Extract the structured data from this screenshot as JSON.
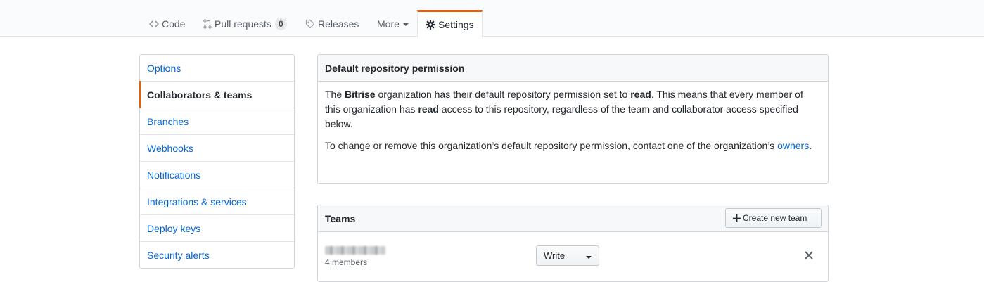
{
  "tabs": [
    {
      "icon": "code-icon",
      "label": "Code"
    },
    {
      "icon": "pull-request-icon",
      "label": "Pull requests",
      "count": "0"
    },
    {
      "icon": "tag-icon",
      "label": "Releases"
    },
    {
      "label": "More"
    },
    {
      "icon": "gear-icon",
      "label": "Settings",
      "selected": true
    }
  ],
  "sidebar": {
    "items": [
      {
        "label": "Options"
      },
      {
        "label": "Collaborators & teams",
        "selected": true
      },
      {
        "label": "Branches"
      },
      {
        "label": "Webhooks"
      },
      {
        "label": "Notifications"
      },
      {
        "label": "Integrations & services"
      },
      {
        "label": "Deploy keys"
      },
      {
        "label": "Security alerts"
      }
    ]
  },
  "permission": {
    "title": "Default repository permission",
    "p1": {
      "t1": "The ",
      "org": "Bitrise",
      "t2": " organization has their default repository permission set to ",
      "level": "read",
      "t3": ". This means that every member of this organization has ",
      "level2": "read",
      "t4": " access to this repository, regardless of the team and collaborator access specified below."
    },
    "p2": {
      "t1": "To change or remove this organization’s default repository permission, contact one of the organization’s ",
      "link": "owners",
      "t2": "."
    }
  },
  "teams": {
    "title": "Teams",
    "create_label": "Create new team",
    "rows": [
      {
        "members": "4 members",
        "permission": "Write"
      }
    ]
  },
  "colors": {
    "accent": "#e36209",
    "link": "#0366d6"
  }
}
